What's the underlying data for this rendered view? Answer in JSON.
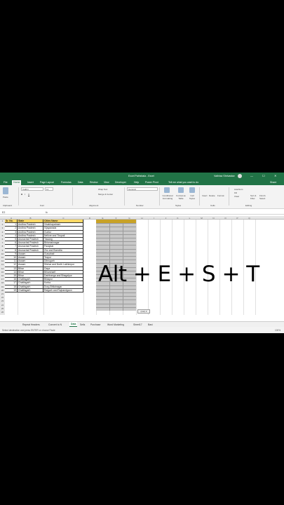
{
  "titlebar": {
    "title": "Excel Pathshala - Excel",
    "user": "Vaibhav Shrivastav",
    "minimize": "—",
    "maximize": "☐",
    "close": "✕"
  },
  "tabs": [
    "File",
    "Home",
    "Insert",
    "Page Layout",
    "Formulas",
    "Data",
    "Review",
    "View",
    "Developer",
    "Help",
    "Power Pivot",
    "Tell me what you want to do",
    "Share"
  ],
  "ribbon": {
    "paste": "Paste",
    "font_name": "Calibri",
    "font_size": "11",
    "wrap_text": "Wrap Text",
    "merge": "Merge & Center",
    "number_format": "General",
    "cond_format": "Conditional Formatting",
    "format_table": "Format as Table",
    "cell_styles": "Cell Styles",
    "insert": "Insert",
    "delete": "Delete",
    "format": "Format",
    "autosum": "AutoSum",
    "fill": "Fill",
    "clear": "Clear",
    "sort": "Sort & Filter",
    "find": "Find & Select",
    "groups": [
      "Clipboard",
      "Font",
      "Alignment",
      "Number",
      "Styles",
      "Cells",
      "Editing"
    ]
  },
  "formula_bar": {
    "name_box": "E2",
    "fx": "fx",
    "value": ""
  },
  "columns": [
    "A",
    "B",
    "C",
    "D",
    "E",
    "F",
    "G",
    "H",
    "I",
    "J",
    "K",
    "L",
    "M",
    "N",
    "O",
    "P",
    "Q"
  ],
  "table": {
    "headers": [
      "Sr. No.",
      "State",
      "Cities Name"
    ],
    "rows": [
      [
        "1",
        "Andhra Pradesh",
        "Visakhapatnam"
      ],
      [
        "2",
        "Andhra Pradesh",
        "Vijayawada"
      ],
      [
        "3",
        "Andhra Pradesh",
        "Guntur"
      ],
      [
        "4",
        "Andhra Pradesh",
        "Nellore and Tirupati"
      ],
      [
        "5",
        "Arunachal Pradesh",
        "Tawang"
      ],
      [
        "6",
        "Arunachal Pradesh",
        "Bhismaknagar"
      ],
      [
        "7",
        "Arunachal Pradesh",
        "Pasighat"
      ],
      [
        "8",
        "Arunachal Pradesh",
        "Ziro and Bomdila"
      ],
      [
        "9",
        "Assam",
        "Guwahati"
      ],
      [
        "10",
        "Assam",
        "Tezpur"
      ],
      [
        "11",
        "Assam",
        "Dibrugarh"
      ],
      [
        "12",
        "Assam",
        "Silchar and North Lakhimpur"
      ],
      [
        "13",
        "Bihar",
        "Gaya"
      ],
      [
        "14",
        "Bihar",
        "Biharsharif"
      ],
      [
        "15",
        "Bihar",
        "Darbhanga and Bhagalpur"
      ],
      [
        "16",
        "Chattisgarh",
        "Bilaspur"
      ],
      [
        "17",
        "Chattisgarh",
        "Korba"
      ],
      [
        "18",
        "Chattisgarh",
        "Durg-Bhilainagar"
      ],
      [
        "19",
        "Chattisgarh",
        "Raigarh and Rajnandgaon"
      ]
    ]
  },
  "overlay_text": "Alt + E + S + T",
  "paste_options": "(Ctrl) ▾",
  "sheet_tabs": [
    "Repeat Headers",
    "Convert to N",
    "Data",
    "Sells",
    "Purchase",
    "Word Marketing",
    "Sheet17",
    "Basi"
  ],
  "active_sheet": "Data",
  "status": {
    "left": "Select destination and press ENTER or choose Paste",
    "zoom": "100%"
  }
}
